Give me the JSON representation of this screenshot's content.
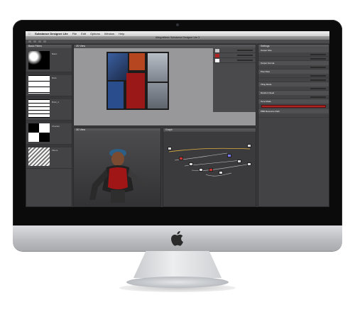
{
  "app": {
    "name": "Substance Designer Lite",
    "window_title": "Allegorithmic Substance Designer Lite 3"
  },
  "menu": {
    "items": [
      "File",
      "Edit",
      "Options",
      "Window",
      "Help"
    ]
  },
  "panels": {
    "library": {
      "title": "Basic Filters",
      "items": [
        "Basic",
        "Brick",
        "Brick_2",
        "Checker",
        "Fibers"
      ]
    },
    "view2d": {
      "title": "2D View"
    },
    "view3d": {
      "title": "3D View"
    },
    "graph": {
      "title": "Graph"
    },
    "params": {
      "title": "Settings",
      "sections": [
        "Output Size",
        "Output Format",
        "Pixel Size",
        "Tiling Mode",
        "Random Seed",
        "Tone Mode",
        "PBR Resource Path"
      ]
    }
  },
  "colors": {
    "accent_red": "#b02323",
    "screen_bg": "#3a3a3c",
    "panel_bg": "#434345"
  }
}
